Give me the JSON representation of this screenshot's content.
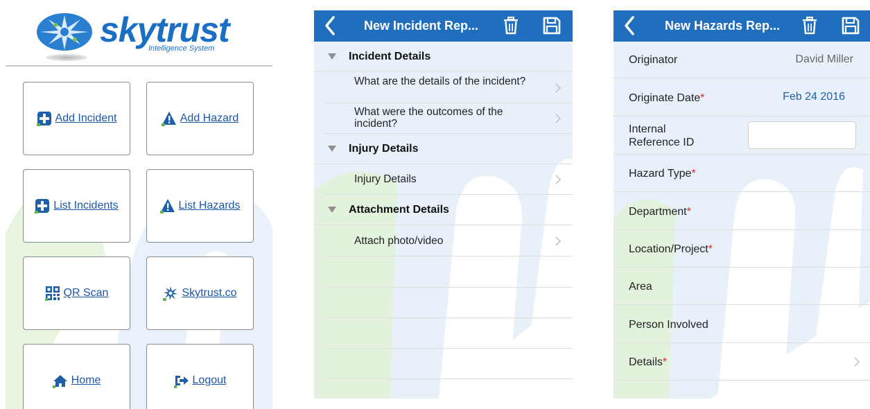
{
  "logo": {
    "name": "skytrust",
    "subtitle": "Intelligence System"
  },
  "menu": {
    "tiles": [
      {
        "label": "Add Incident",
        "icon": "add-incident-icon"
      },
      {
        "label": "Add Hazard",
        "icon": "add-hazard-icon"
      },
      {
        "label": "List Incidents",
        "icon": "list-incidents-icon"
      },
      {
        "label": "List Hazards",
        "icon": "list-hazards-icon"
      },
      {
        "label": "QR Scan",
        "icon": "qr-code-icon"
      },
      {
        "label": "Skytrust.co",
        "icon": "skytrust-logo-icon"
      },
      {
        "label": "Home",
        "icon": "home-icon"
      },
      {
        "label": "Logout",
        "icon": "logout-icon"
      }
    ]
  },
  "incident": {
    "title": "New Incident Rep...",
    "sections": [
      {
        "label": "Incident Details",
        "rows": [
          "What are the details of the incident?",
          "What were the outcomes of the incident?"
        ]
      },
      {
        "label": "Injury Details",
        "rows": [
          "Injury Details"
        ]
      },
      {
        "label": "Attachment Details",
        "rows": [
          "Attach photo/video"
        ]
      }
    ]
  },
  "hazard": {
    "title": "New Hazards Rep...",
    "fields": [
      {
        "label": "Originator",
        "required": false,
        "value": "David Miller"
      },
      {
        "label": "Originate Date",
        "required": true,
        "value": "Feb 24 2016"
      },
      {
        "label": "Internal Reference ID",
        "required": false,
        "value": ""
      },
      {
        "label": "Hazard Type",
        "required": true,
        "value": ""
      },
      {
        "label": "Department",
        "required": true,
        "value": ""
      },
      {
        "label": "Location/Project",
        "required": true,
        "value": ""
      },
      {
        "label": "Area",
        "required": false,
        "value": ""
      },
      {
        "label": "Person Involved",
        "required": false,
        "value": ""
      },
      {
        "label": "Details",
        "required": true,
        "value": ""
      }
    ],
    "required_marker": "*"
  },
  "colors": {
    "brand_blue": "#1a6fc4",
    "navbar": "#1f6fbe",
    "link": "#1c56a8",
    "required": "#e0282b",
    "date_value": "#1f5fa8",
    "muted_value": "#666666"
  }
}
